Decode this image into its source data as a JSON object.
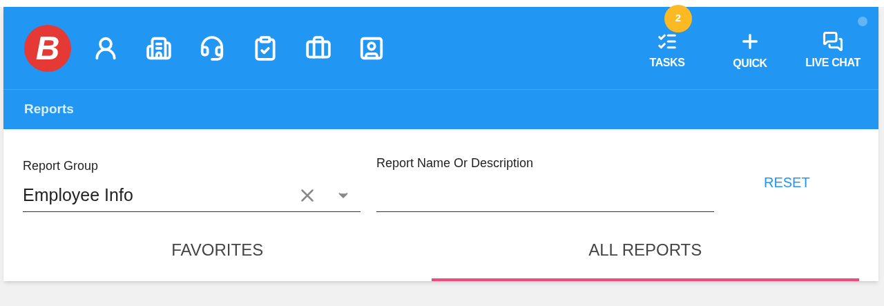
{
  "logo": {
    "letter": "B"
  },
  "actions": [
    {
      "kind": "tasks",
      "label": "TASKS",
      "badge": "2"
    },
    {
      "kind": "quick",
      "label": "QUICK"
    },
    {
      "kind": "chat",
      "label": "LIVE CHAT"
    }
  ],
  "breadcrumb": "Reports",
  "fields": [
    {
      "label": "Report Group",
      "value": "Employee Info",
      "kind": "select"
    },
    {
      "label": "Report Name Or Description",
      "kind": "text"
    }
  ],
  "reset_button": "RESET",
  "tabs": [
    {
      "label": "FAVORITES",
      "selected": false
    },
    {
      "label": "ALL REPORTS",
      "selected": true
    }
  ]
}
